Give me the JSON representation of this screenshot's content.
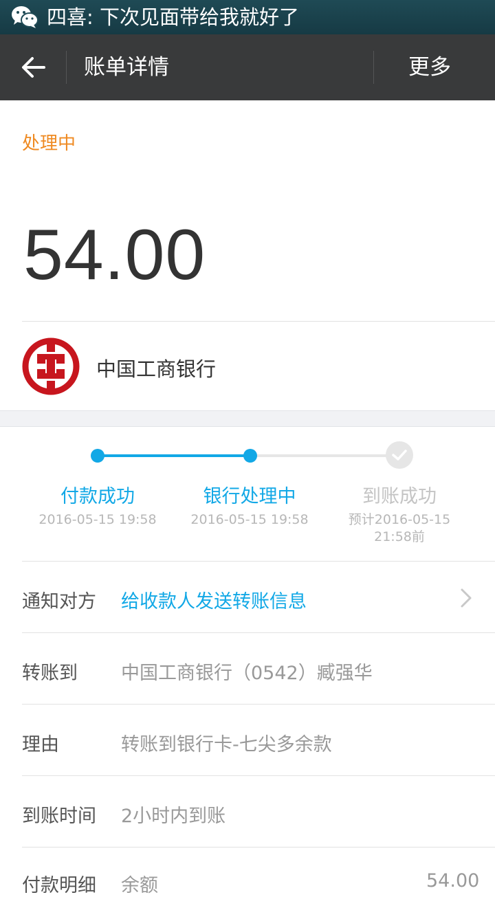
{
  "notification": {
    "text": "四喜: 下次见面带给我就好了",
    "icon": "wechat-icon"
  },
  "header": {
    "title": "账单详情",
    "more_label": "更多",
    "back_icon": "back-arrow-icon"
  },
  "bill": {
    "status": "处理中",
    "amount": "54.00",
    "bank_name": "中国工商银行",
    "bank_logo": "icbc-logo"
  },
  "progress": {
    "steps": [
      {
        "label": "付款成功",
        "time": "2016-05-15 19:58",
        "state": "done"
      },
      {
        "label": "银行处理中",
        "time": "2016-05-15 19:58",
        "state": "current"
      },
      {
        "label": "到账成功",
        "time": "预计2016-05-15 21:58前",
        "state": "pending"
      }
    ]
  },
  "details": {
    "notify": {
      "label": "通知对方",
      "value": "给收款人发送转账信息"
    },
    "transfer_to": {
      "label": "转账到",
      "value": "中国工商银行（0542）臧强华"
    },
    "reason": {
      "label": "理由",
      "value": "转账到银行卡-七尖多余款"
    },
    "arrival_time": {
      "label": "到账时间",
      "value": "2小时内到账"
    },
    "payment_detail": {
      "label": "付款明细",
      "sub_label": "余额",
      "value": "54.00"
    }
  },
  "colors": {
    "accent": "#12a8e6",
    "status": "#ef8a22",
    "header_bg": "#393a3b",
    "icbc_red": "#c7161e"
  }
}
